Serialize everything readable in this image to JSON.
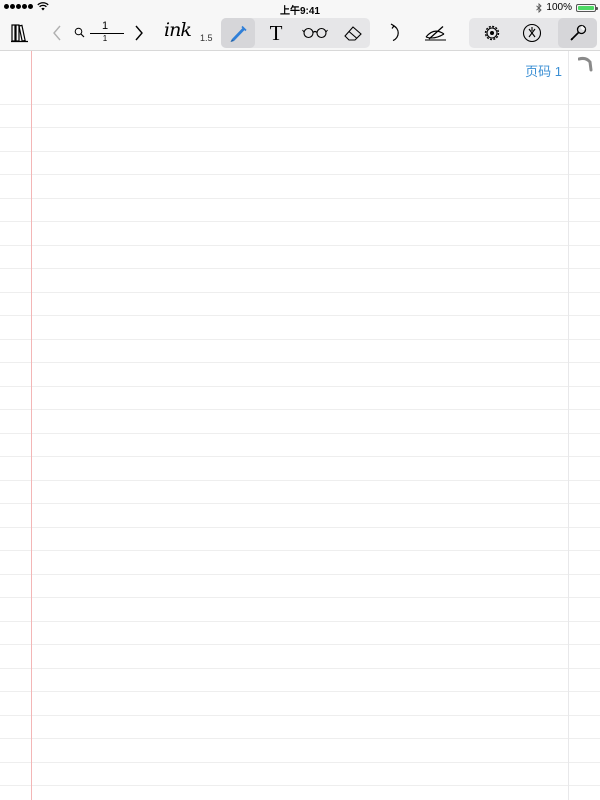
{
  "status": {
    "time": "上午9:41",
    "battery": "100%",
    "battery_level": 1.0
  },
  "toolbar": {
    "library_icon": "books-icon",
    "prev_icon": "chevron-left-icon",
    "next_icon": "chevron-right-icon",
    "page_current": "1",
    "page_total": "1",
    "ink_label": "ink",
    "ink_size": "1.5",
    "tools": [
      "pen-icon",
      "text-icon",
      "glasses-icon",
      "eraser-icon"
    ],
    "text_tool_label": "T",
    "undo_icon": "undo-icon",
    "hide-pen_icon": "eye-pen-icon",
    "settings_icons": [
      "gear-icon",
      "compass-icon",
      "wrench-icon"
    ],
    "accent": "#2f7fd8"
  },
  "page": {
    "label": "页码 1",
    "label_color": "#3b8fd4",
    "margin_color": "#f3b6b6",
    "rule_color": "#dcdcdc"
  }
}
